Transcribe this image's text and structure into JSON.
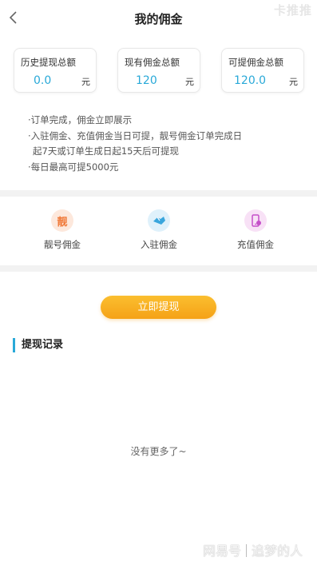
{
  "header": {
    "title": "我的佣金",
    "watermark": "卡推推"
  },
  "stats": [
    {
      "label": "历史提现总额",
      "value": "0.0",
      "unit": "元"
    },
    {
      "label": "现有佣金总额",
      "value": "120",
      "unit": "元"
    },
    {
      "label": "可提佣金总额",
      "value": "120.0",
      "unit": "元"
    }
  ],
  "notes": [
    "·订单完成，佣金立即展示",
    "·入驻佣金、充值佣金当日可提，靓号佣金订单完成日",
    "起7天或订单生成日起15天后可提现",
    "·每日最高可提5000元"
  ],
  "categories": [
    {
      "label": "靓号佣金",
      "icon_char": "靓",
      "icon": "pretty-number-icon"
    },
    {
      "label": "入驻佣金",
      "icon": "handshake-icon"
    },
    {
      "label": "充值佣金",
      "icon": "phone-recharge-icon"
    }
  ],
  "withdraw_button": "立即提现",
  "records": {
    "title": "提现记录",
    "empty_text": "没有更多了~"
  },
  "footer_watermark": {
    "left": "网易号",
    "right": "追梦的人"
  },
  "colors": {
    "accent": "#29a9d8",
    "button": "#f5a217",
    "pretty_icon": "#fde8dc",
    "join_icon": "#dff1fb",
    "recharge_icon": "#f8e1f6"
  }
}
